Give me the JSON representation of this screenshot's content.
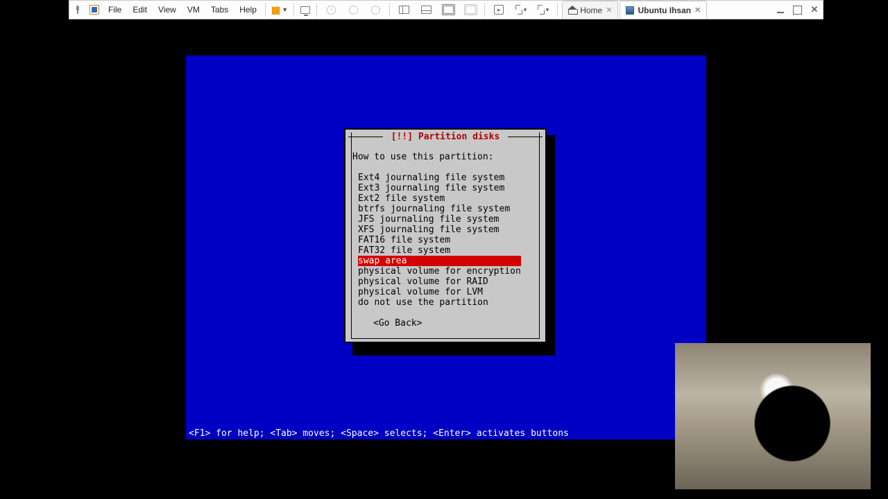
{
  "toolbar": {
    "menus": [
      "File",
      "Edit",
      "View",
      "VM",
      "Tabs",
      "Help"
    ],
    "tabs": [
      {
        "label": "Home",
        "active": false
      },
      {
        "label": "Ubuntu Ihsan",
        "active": true
      }
    ]
  },
  "dialog": {
    "title": "[!!] Partition disks",
    "prompt": "How to use this partition:",
    "options": [
      "Ext4 journaling file system",
      "Ext3 journaling file system",
      "Ext2 file system",
      "btrfs journaling file system",
      "JFS journaling file system",
      "XFS journaling file system",
      "FAT16 file system",
      "FAT32 file system",
      "swap area",
      "physical volume for encryption",
      "physical volume for RAID",
      "physical volume for LVM",
      "do not use the partition"
    ],
    "selected_index": 8,
    "go_back": "<Go Back>"
  },
  "statusbar": "<F1> for help; <Tab> moves; <Space> selects; <Enter> activates buttons"
}
